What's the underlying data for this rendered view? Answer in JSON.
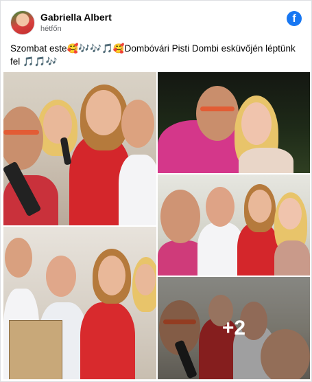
{
  "post": {
    "author": "Gabriella Albert",
    "timestamp": "hétfőn",
    "text": "Szombat este🥰🎶🎶🎵🥰Dombóvári Pisti Dombi esküvőjén léptünk fel 🎵🎵🎶"
  },
  "icons": {
    "platform": "facebook-icon",
    "avatar": "avatar"
  },
  "gallery": {
    "photo_count_visible": 5,
    "more_label": "+2"
  },
  "colors": {
    "facebook_blue": "#1877f2",
    "text_primary": "#050505",
    "text_secondary": "#65676b"
  }
}
